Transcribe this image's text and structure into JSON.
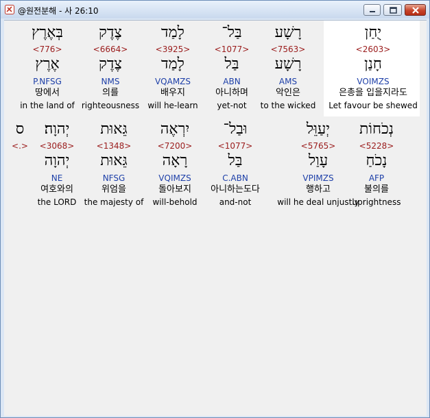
{
  "window": {
    "title": "@원전분해 - 사 26:10",
    "buttons": [
      "minimize",
      "maximize",
      "close"
    ]
  },
  "colors": {
    "strong": "#9a1b1b",
    "morph": "#1d3fa8",
    "highlight": "#ffffff"
  },
  "rows": [
    [
      {
        "word": "יֻחַן",
        "strong": "<2603>",
        "lemma": "חָנַן",
        "morph": "VOIMZS",
        "kor": "은총을 입을지라도",
        "eng": "Let favour be shewed",
        "selected": true
      },
      {
        "word": "רָשָׁע",
        "strong": "<7563>",
        "lemma": "רָשָׁע",
        "morph": "AMS",
        "kor": "악인은",
        "eng": "to the wicked"
      },
      {
        "word": "בַּל־",
        "strong": "<1077>",
        "lemma": "בַּל",
        "morph": "ABN",
        "kor": "아니하며",
        "eng": "yet-not"
      },
      {
        "word": "לָמַד",
        "strong": "<3925>",
        "lemma": "לָמַד",
        "morph": "VQAMZS",
        "kor": "배우지",
        "eng": "will he-learn"
      },
      {
        "word": "צֶדֶק",
        "strong": "<6664>",
        "lemma": "צֶדֶק",
        "morph": "NMS",
        "kor": "의를",
        "eng": "righteousness"
      },
      {
        "word": "בְּאֶרֶץ",
        "strong": "<776>",
        "lemma": "אֶרֶץ",
        "morph": "P.NFSG",
        "kor": "땅에서",
        "eng": "in the land of"
      }
    ],
    [
      {
        "word": "נְכֹחוֹת",
        "strong": "<5228>",
        "lemma": "נָכֹחַ",
        "morph": "AFP",
        "kor": "불의를",
        "eng": "uprightness"
      },
      {
        "word": "יְעַוֵּל",
        "strong": "<5765>",
        "lemma": "עָוַל",
        "morph": "VPIMZS",
        "kor": "행하고",
        "eng": "will he deal unjustly"
      },
      {
        "word": "וּבַל־",
        "strong": "<1077>",
        "lemma": "בַּל",
        "morph": "C.ABN",
        "kor": "아니하는도다",
        "eng": "and-not"
      },
      {
        "word": "יִרְאֶה",
        "strong": "<7200>",
        "lemma": "רָאָה",
        "morph": "VQIMZS",
        "kor": "돌아보지",
        "eng": "will-behold"
      },
      {
        "word": "גֵּאוּת",
        "strong": "<1348>",
        "lemma": "גֵּאוּת",
        "morph": "NFSG",
        "kor": "위엄을",
        "eng": "the majesty of"
      },
      {
        "word": "יְהוָה׃",
        "strong": "<3068>",
        "lemma": "יְהוָה",
        "morph": "NE",
        "kor": "여호와의",
        "eng": "the LORD"
      },
      {
        "word": "ס",
        "strong": "<.>",
        "lemma": "",
        "morph": "",
        "kor": "",
        "eng": ""
      }
    ]
  ]
}
